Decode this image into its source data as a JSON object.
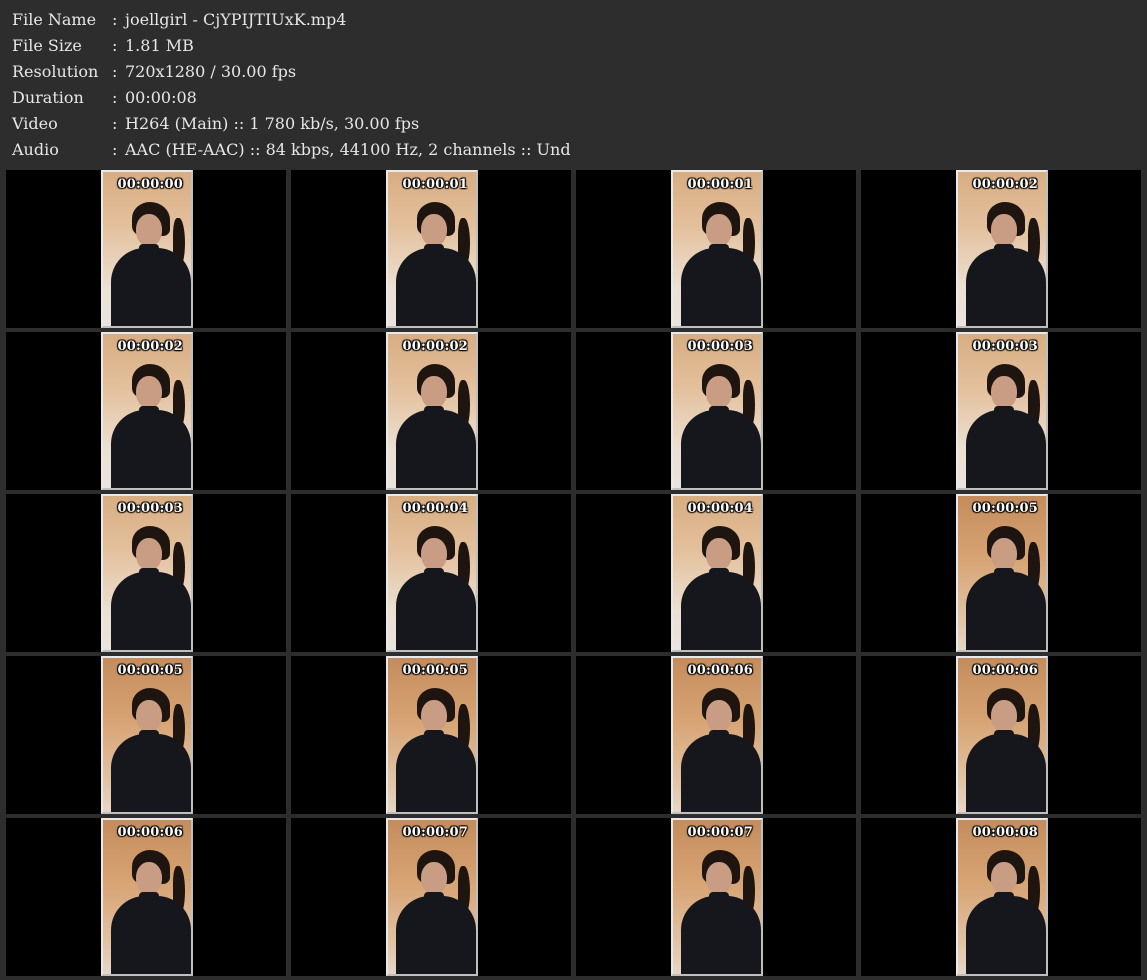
{
  "info": [
    {
      "label": "File Name",
      "value": "joellgirl - CjYPIJTIUxK.mp4"
    },
    {
      "label": "File Size",
      "value": "1.81 MB"
    },
    {
      "label": "Resolution",
      "value": "720x1280 / 30.00 fps"
    },
    {
      "label": "Duration",
      "value": "00:00:08"
    },
    {
      "label": "Video",
      "value": "H264 (Main) :: 1 780 kb/s, 30.00 fps"
    },
    {
      "label": "Audio",
      "value": "AAC (HE-AAC) :: 84 kbps, 44100 Hz, 2 channels :: Und"
    }
  ],
  "separator": ":",
  "thumbnails": [
    {
      "timestamp": "00:00:00"
    },
    {
      "timestamp": "00:00:01"
    },
    {
      "timestamp": "00:00:01"
    },
    {
      "timestamp": "00:00:02"
    },
    {
      "timestamp": "00:00:02"
    },
    {
      "timestamp": "00:00:02"
    },
    {
      "timestamp": "00:00:03"
    },
    {
      "timestamp": "00:00:03"
    },
    {
      "timestamp": "00:00:03"
    },
    {
      "timestamp": "00:00:04"
    },
    {
      "timestamp": "00:00:04"
    },
    {
      "timestamp": "00:00:05"
    },
    {
      "timestamp": "00:00:05"
    },
    {
      "timestamp": "00:00:05"
    },
    {
      "timestamp": "00:00:06"
    },
    {
      "timestamp": "00:00:06"
    },
    {
      "timestamp": "00:00:06"
    },
    {
      "timestamp": "00:00:07"
    },
    {
      "timestamp": "00:00:07"
    },
    {
      "timestamp": "00:00:08"
    }
  ],
  "colors": {
    "background": "#2d2d2d",
    "cell_background": "#000000",
    "text": "#e6e6e6"
  }
}
